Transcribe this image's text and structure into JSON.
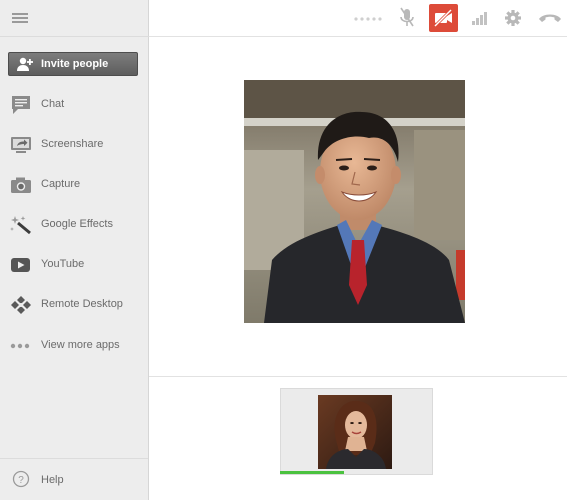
{
  "sidebar": {
    "invite_label": "Invite people",
    "items": [
      {
        "label": "Chat",
        "icon": "chat-icon"
      },
      {
        "label": "Screenshare",
        "icon": "screenshare-icon"
      },
      {
        "label": "Capture",
        "icon": "camera-icon"
      },
      {
        "label": "Google Effects",
        "icon": "effects-wand-icon"
      },
      {
        "label": "YouTube",
        "icon": "youtube-play-icon"
      },
      {
        "label": "Remote Desktop",
        "icon": "remote-desktop-icon"
      },
      {
        "label": "View more apps",
        "icon": "more-dots-icon"
      }
    ],
    "help_label": "Help"
  },
  "toolbar": {
    "icons": [
      "dots-icon",
      "mic-mute-icon",
      "camera-off-icon",
      "signal-bars-icon",
      "gear-icon",
      "hangup-icon"
    ],
    "camera_off_active": true,
    "accent_color": "#dd4b39"
  },
  "main_video": {
    "subject": "man in suit"
  },
  "filmstrip": {
    "participants": [
      {
        "subject": "woman with brown hair",
        "audio_level": 0.42
      }
    ]
  },
  "colors": {
    "sidebar_bg": "#ededed",
    "audio_green": "#4bc23f",
    "invite_button": "#6b6b6b"
  }
}
